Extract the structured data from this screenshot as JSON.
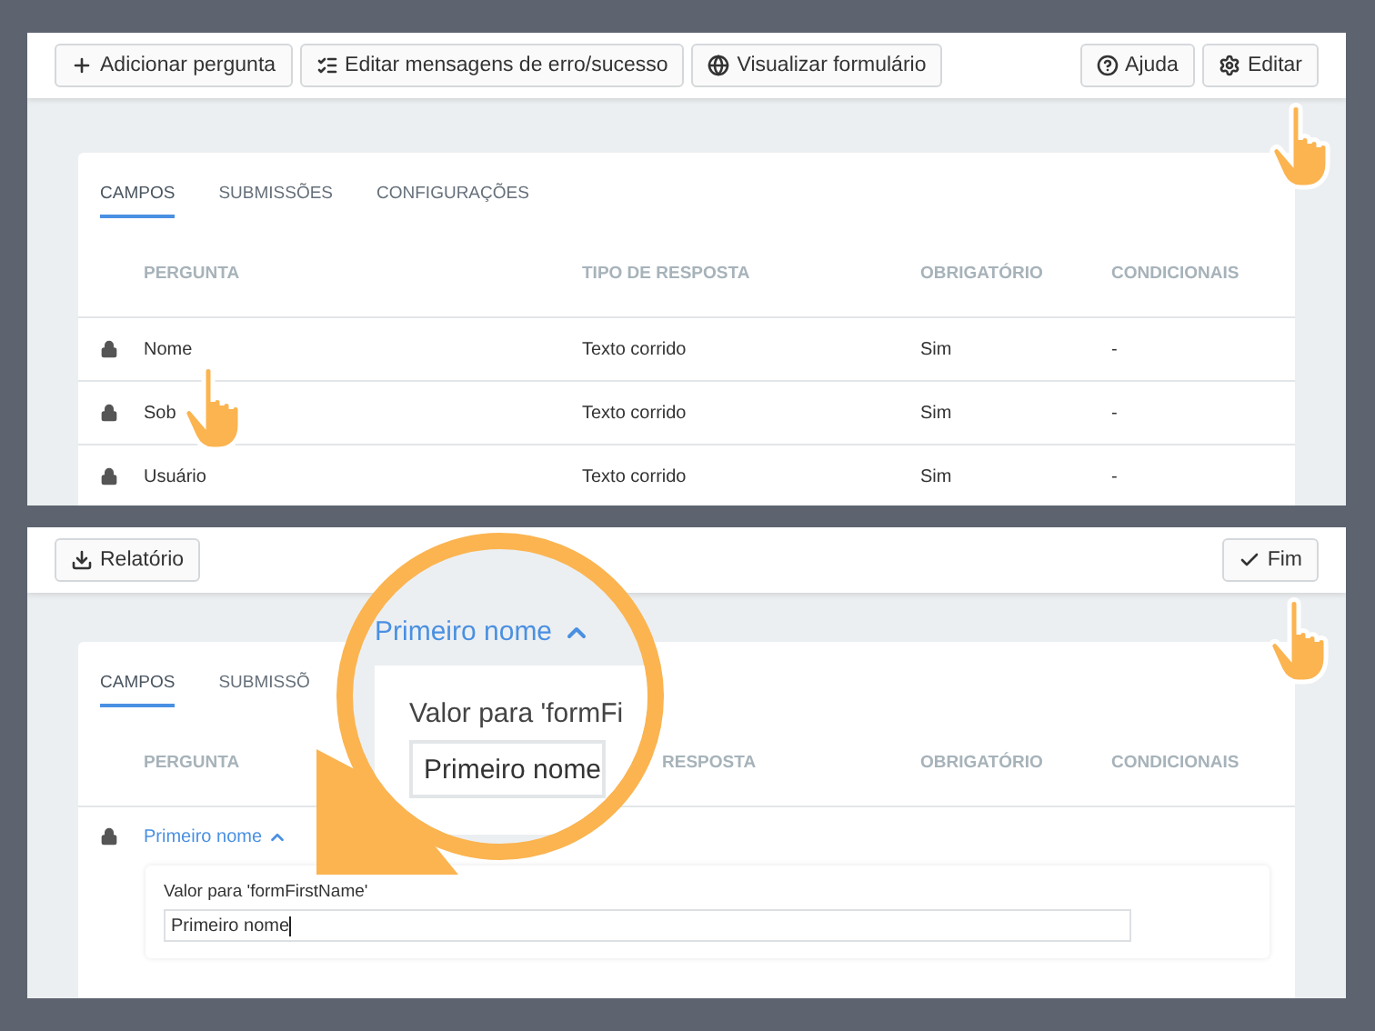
{
  "top_screen": {
    "toolbar_left": [
      {
        "label": "Adicionar pergunta"
      },
      {
        "label": "Editar mensagens de erro/sucesso"
      },
      {
        "label": "Visualizar formulário"
      }
    ],
    "toolbar_right": [
      {
        "label": "Ajuda"
      },
      {
        "label": "Editar"
      }
    ],
    "tabs": [
      {
        "label": "CAMPOS",
        "selected": true
      },
      {
        "label": "SUBMISSÕES",
        "selected": false
      },
      {
        "label": "CONFIGURAÇÕES",
        "selected": false
      }
    ],
    "columns": [
      "PERGUNTA",
      "TIPO DE RESPOSTA",
      "OBRIGATÓRIO",
      "CONDICIONAIS"
    ],
    "rows": [
      {
        "cells": [
          "Nome",
          "Texto corrido",
          "Sim",
          "-"
        ]
      },
      {
        "cells": [
          "Sob",
          "Texto corrido",
          "Sim",
          "-"
        ]
      },
      {
        "cells": [
          "Usuário",
          "Texto corrido",
          "Sim",
          "-"
        ]
      }
    ]
  },
  "bottom_screen": {
    "toolbar_left": [
      {
        "label": "Relatório"
      }
    ],
    "toolbar_right": [
      {
        "label": "Fim"
      }
    ],
    "tabs": [
      {
        "label": "CAMPOS",
        "selected": true
      },
      {
        "label": "SUBMISSÕ",
        "selected": false
      }
    ],
    "columns": [
      "PERGUNTA",
      "RESPOSTA",
      "OBRIGATÓRIO",
      "CONDICIONAIS"
    ],
    "rows": [
      {
        "label": "Primeiro nome",
        "expanded": true,
        "field_label": "Valor para 'formFirstName'",
        "value": "Primeiro nome"
      }
    ]
  },
  "magnifier": {
    "question": "Primeiro nome",
    "field_label": "Valor para 'formFi",
    "value": "Primeiro nome"
  }
}
